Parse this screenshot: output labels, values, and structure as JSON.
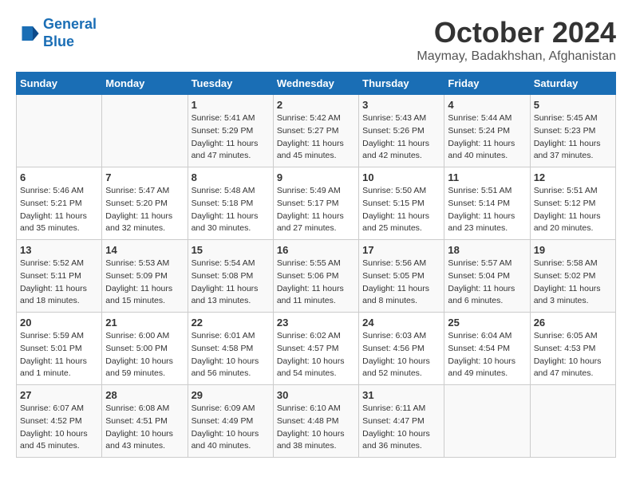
{
  "header": {
    "logo_line1": "General",
    "logo_line2": "Blue",
    "month": "October 2024",
    "location": "Maymay, Badakhshan, Afghanistan"
  },
  "days_of_week": [
    "Sunday",
    "Monday",
    "Tuesday",
    "Wednesday",
    "Thursday",
    "Friday",
    "Saturday"
  ],
  "weeks": [
    [
      {
        "day": "",
        "info": ""
      },
      {
        "day": "",
        "info": ""
      },
      {
        "day": "1",
        "info": "Sunrise: 5:41 AM\nSunset: 5:29 PM\nDaylight: 11 hours and 47 minutes."
      },
      {
        "day": "2",
        "info": "Sunrise: 5:42 AM\nSunset: 5:27 PM\nDaylight: 11 hours and 45 minutes."
      },
      {
        "day": "3",
        "info": "Sunrise: 5:43 AM\nSunset: 5:26 PM\nDaylight: 11 hours and 42 minutes."
      },
      {
        "day": "4",
        "info": "Sunrise: 5:44 AM\nSunset: 5:24 PM\nDaylight: 11 hours and 40 minutes."
      },
      {
        "day": "5",
        "info": "Sunrise: 5:45 AM\nSunset: 5:23 PM\nDaylight: 11 hours and 37 minutes."
      }
    ],
    [
      {
        "day": "6",
        "info": "Sunrise: 5:46 AM\nSunset: 5:21 PM\nDaylight: 11 hours and 35 minutes."
      },
      {
        "day": "7",
        "info": "Sunrise: 5:47 AM\nSunset: 5:20 PM\nDaylight: 11 hours and 32 minutes."
      },
      {
        "day": "8",
        "info": "Sunrise: 5:48 AM\nSunset: 5:18 PM\nDaylight: 11 hours and 30 minutes."
      },
      {
        "day": "9",
        "info": "Sunrise: 5:49 AM\nSunset: 5:17 PM\nDaylight: 11 hours and 27 minutes."
      },
      {
        "day": "10",
        "info": "Sunrise: 5:50 AM\nSunset: 5:15 PM\nDaylight: 11 hours and 25 minutes."
      },
      {
        "day": "11",
        "info": "Sunrise: 5:51 AM\nSunset: 5:14 PM\nDaylight: 11 hours and 23 minutes."
      },
      {
        "day": "12",
        "info": "Sunrise: 5:51 AM\nSunset: 5:12 PM\nDaylight: 11 hours and 20 minutes."
      }
    ],
    [
      {
        "day": "13",
        "info": "Sunrise: 5:52 AM\nSunset: 5:11 PM\nDaylight: 11 hours and 18 minutes."
      },
      {
        "day": "14",
        "info": "Sunrise: 5:53 AM\nSunset: 5:09 PM\nDaylight: 11 hours and 15 minutes."
      },
      {
        "day": "15",
        "info": "Sunrise: 5:54 AM\nSunset: 5:08 PM\nDaylight: 11 hours and 13 minutes."
      },
      {
        "day": "16",
        "info": "Sunrise: 5:55 AM\nSunset: 5:06 PM\nDaylight: 11 hours and 11 minutes."
      },
      {
        "day": "17",
        "info": "Sunrise: 5:56 AM\nSunset: 5:05 PM\nDaylight: 11 hours and 8 minutes."
      },
      {
        "day": "18",
        "info": "Sunrise: 5:57 AM\nSunset: 5:04 PM\nDaylight: 11 hours and 6 minutes."
      },
      {
        "day": "19",
        "info": "Sunrise: 5:58 AM\nSunset: 5:02 PM\nDaylight: 11 hours and 3 minutes."
      }
    ],
    [
      {
        "day": "20",
        "info": "Sunrise: 5:59 AM\nSunset: 5:01 PM\nDaylight: 11 hours and 1 minute."
      },
      {
        "day": "21",
        "info": "Sunrise: 6:00 AM\nSunset: 5:00 PM\nDaylight: 10 hours and 59 minutes."
      },
      {
        "day": "22",
        "info": "Sunrise: 6:01 AM\nSunset: 4:58 PM\nDaylight: 10 hours and 56 minutes."
      },
      {
        "day": "23",
        "info": "Sunrise: 6:02 AM\nSunset: 4:57 PM\nDaylight: 10 hours and 54 minutes."
      },
      {
        "day": "24",
        "info": "Sunrise: 6:03 AM\nSunset: 4:56 PM\nDaylight: 10 hours and 52 minutes."
      },
      {
        "day": "25",
        "info": "Sunrise: 6:04 AM\nSunset: 4:54 PM\nDaylight: 10 hours and 49 minutes."
      },
      {
        "day": "26",
        "info": "Sunrise: 6:05 AM\nSunset: 4:53 PM\nDaylight: 10 hours and 47 minutes."
      }
    ],
    [
      {
        "day": "27",
        "info": "Sunrise: 6:07 AM\nSunset: 4:52 PM\nDaylight: 10 hours and 45 minutes."
      },
      {
        "day": "28",
        "info": "Sunrise: 6:08 AM\nSunset: 4:51 PM\nDaylight: 10 hours and 43 minutes."
      },
      {
        "day": "29",
        "info": "Sunrise: 6:09 AM\nSunset: 4:49 PM\nDaylight: 10 hours and 40 minutes."
      },
      {
        "day": "30",
        "info": "Sunrise: 6:10 AM\nSunset: 4:48 PM\nDaylight: 10 hours and 38 minutes."
      },
      {
        "day": "31",
        "info": "Sunrise: 6:11 AM\nSunset: 4:47 PM\nDaylight: 10 hours and 36 minutes."
      },
      {
        "day": "",
        "info": ""
      },
      {
        "day": "",
        "info": ""
      }
    ]
  ]
}
